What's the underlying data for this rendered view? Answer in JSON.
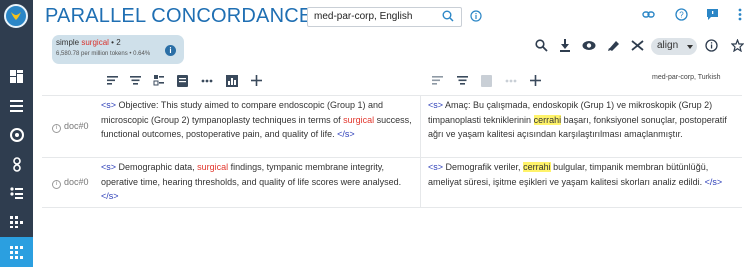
{
  "app": {
    "title": "PARALLEL CONCORDANCE"
  },
  "corpus_selector": {
    "value": "med-par-corp, English"
  },
  "query": {
    "type_label": "simple",
    "keyword": "surgical",
    "count_suffix": "• 2",
    "stats_text": "6,580.78 per million tokens • 0.64%"
  },
  "toolbar": {
    "align_label": "align"
  },
  "right_panel": {
    "corpus_label": "med-par-corp, Turkish"
  },
  "rows": [
    {
      "doc": "doc#0",
      "src_before": "Objective: This study aimed to compare endoscopic (Group 1) and microscopic (Group 2) tympanoplasty techniques in terms of",
      "src_kw": "surgical",
      "src_after": "success, functional outcomes, postoperative pain, and quality of life.",
      "tgt_before": "Amaç: Bu çalışmada, endoskopik (Grup 1) ve mikroskopik (Grup 2) timpanoplasti tekniklerinin",
      "tgt_hl": "cerrahi",
      "tgt_after": "başarı, fonksiyonel sonuçlar, postoperatif ağrı ve yaşam kalitesi açısından karşılaştırılması amaçlanmıştır."
    },
    {
      "doc": "doc#0",
      "src_before": "Demographic data,",
      "src_kw": "surgical",
      "src_after": "findings, tympanic membrane integrity, operative time, hearing thresholds, and quality of life scores were analysed.",
      "tgt_before": "Demografik veriler,",
      "tgt_hl": "cerrahi",
      "tgt_after": "bulgular, timpanik membran bütünlüğü, ameliyat süresi, işitme eşikleri ve yaşam kalitesi skorları analiz edildi."
    }
  ],
  "tags": {
    "open": "<s>",
    "close": "</s>"
  },
  "colors": {
    "sidebar_bg": "#2f3d4f",
    "sidebar_active": "#2b9fe0",
    "title": "#1f6fb3",
    "keyword": "#e2372d",
    "highlight": "#fff36a",
    "tag": "#2b3db8"
  }
}
